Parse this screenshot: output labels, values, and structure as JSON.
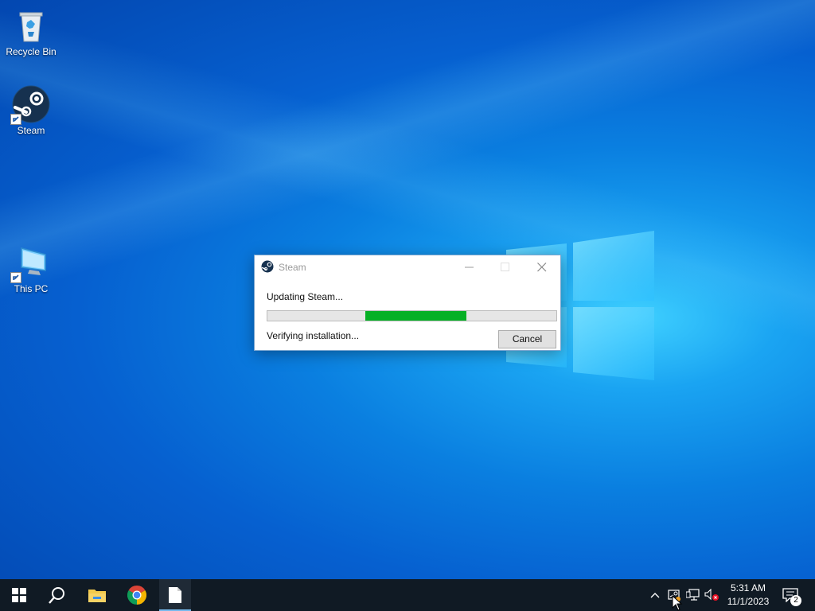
{
  "desktop": {
    "icons": [
      {
        "label": "Recycle Bin",
        "icon": "recycle-bin-icon"
      },
      {
        "label": "Steam",
        "icon": "steam-icon"
      },
      {
        "label": "This PC",
        "icon": "this-pc-icon"
      }
    ]
  },
  "dialog": {
    "title": "Steam",
    "status": "Updating Steam...",
    "substatus": "Verifying installation...",
    "cancel_label": "Cancel",
    "progress": {
      "start_fraction": 0.34,
      "end_fraction": 0.69,
      "color": "#06b025"
    }
  },
  "taskbar": {
    "apps": [
      {
        "name": "start",
        "icon": "windows-start-icon"
      },
      {
        "name": "search",
        "icon": "search-icon"
      },
      {
        "name": "file-explorer",
        "icon": "file-explorer-icon"
      },
      {
        "name": "chrome",
        "icon": "chrome-icon"
      },
      {
        "name": "notepad",
        "icon": "document-icon",
        "active": true
      }
    ],
    "tray": {
      "time": "5:31 AM",
      "date": "11/1/2023",
      "notification_count": "2",
      "icons": [
        "chevron-up-icon",
        "steam-tray-icon",
        "network-icon",
        "volume-muted-icon"
      ]
    }
  },
  "colors": {
    "accent": "#0078d7",
    "taskbar": "#101a24",
    "progress_fill": "#06b025"
  }
}
